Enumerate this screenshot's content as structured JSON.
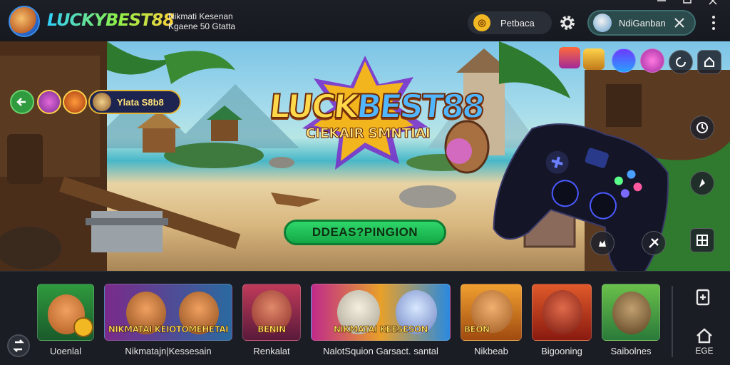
{
  "header": {
    "brand": "LUCKYBEST88",
    "tagline": "Nikmati Kesenan Kgaene 50 Gtatta",
    "coin_label": "Petbaca",
    "user_name": "NdiGanban"
  },
  "hero": {
    "title_part1": "LUCK",
    "title_part2": "BEST88",
    "subtitle": "CIEKAIR SMNTIAI",
    "cta_label": "DDEAS?PINGION",
    "promo_label": "Ylata S8b8"
  },
  "games": [
    {
      "label": "Uoenlal",
      "banner": ""
    },
    {
      "label": "Nikmatajn|Kessesain",
      "banner": "NIKMATAI KEIOTOMEHETAI"
    },
    {
      "label": "Renkalat",
      "banner": "BENIN"
    },
    {
      "label": "NalotSquion Garsact. santal",
      "banner": "NIKMATAI KEESESON"
    },
    {
      "label": "Nikbeab",
      "banner": "BEON"
    },
    {
      "label": "Bigooning",
      "banner": ""
    },
    {
      "label": "Saibolnes",
      "banner": ""
    }
  ],
  "sidebar": {
    "bottom_label": "EGE"
  },
  "colors": {
    "brand_blue": "#2fd0ff",
    "brand_gold": "#ffd23a",
    "cta_green": "#13a846",
    "background": "#14171d"
  },
  "icons": [
    "settings-gear-icon",
    "close-icon",
    "minimize-icon",
    "maximize-icon",
    "window-close-icon",
    "more-vertical-icon",
    "back-arrow-icon",
    "home-icon"
  ]
}
